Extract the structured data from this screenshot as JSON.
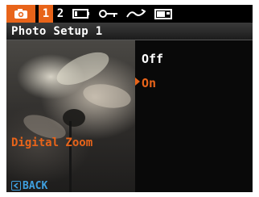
{
  "tabs": {
    "camera_icon": "camera-icon",
    "page1": "1",
    "page2": "2",
    "icons": [
      "battery-icon",
      "key-icon",
      "wave-icon",
      "camera-body-icon"
    ]
  },
  "header": {
    "title": "Photo Setup 1"
  },
  "menu": {
    "setting_label": "Digital Zoom",
    "options": [
      "Off",
      "On"
    ],
    "selected": "On"
  },
  "footer": {
    "back_label": "BACK",
    "back_icon": "back-arrow-icon"
  },
  "colors": {
    "accent": "#e8641a",
    "back": "#3fa0e0"
  }
}
